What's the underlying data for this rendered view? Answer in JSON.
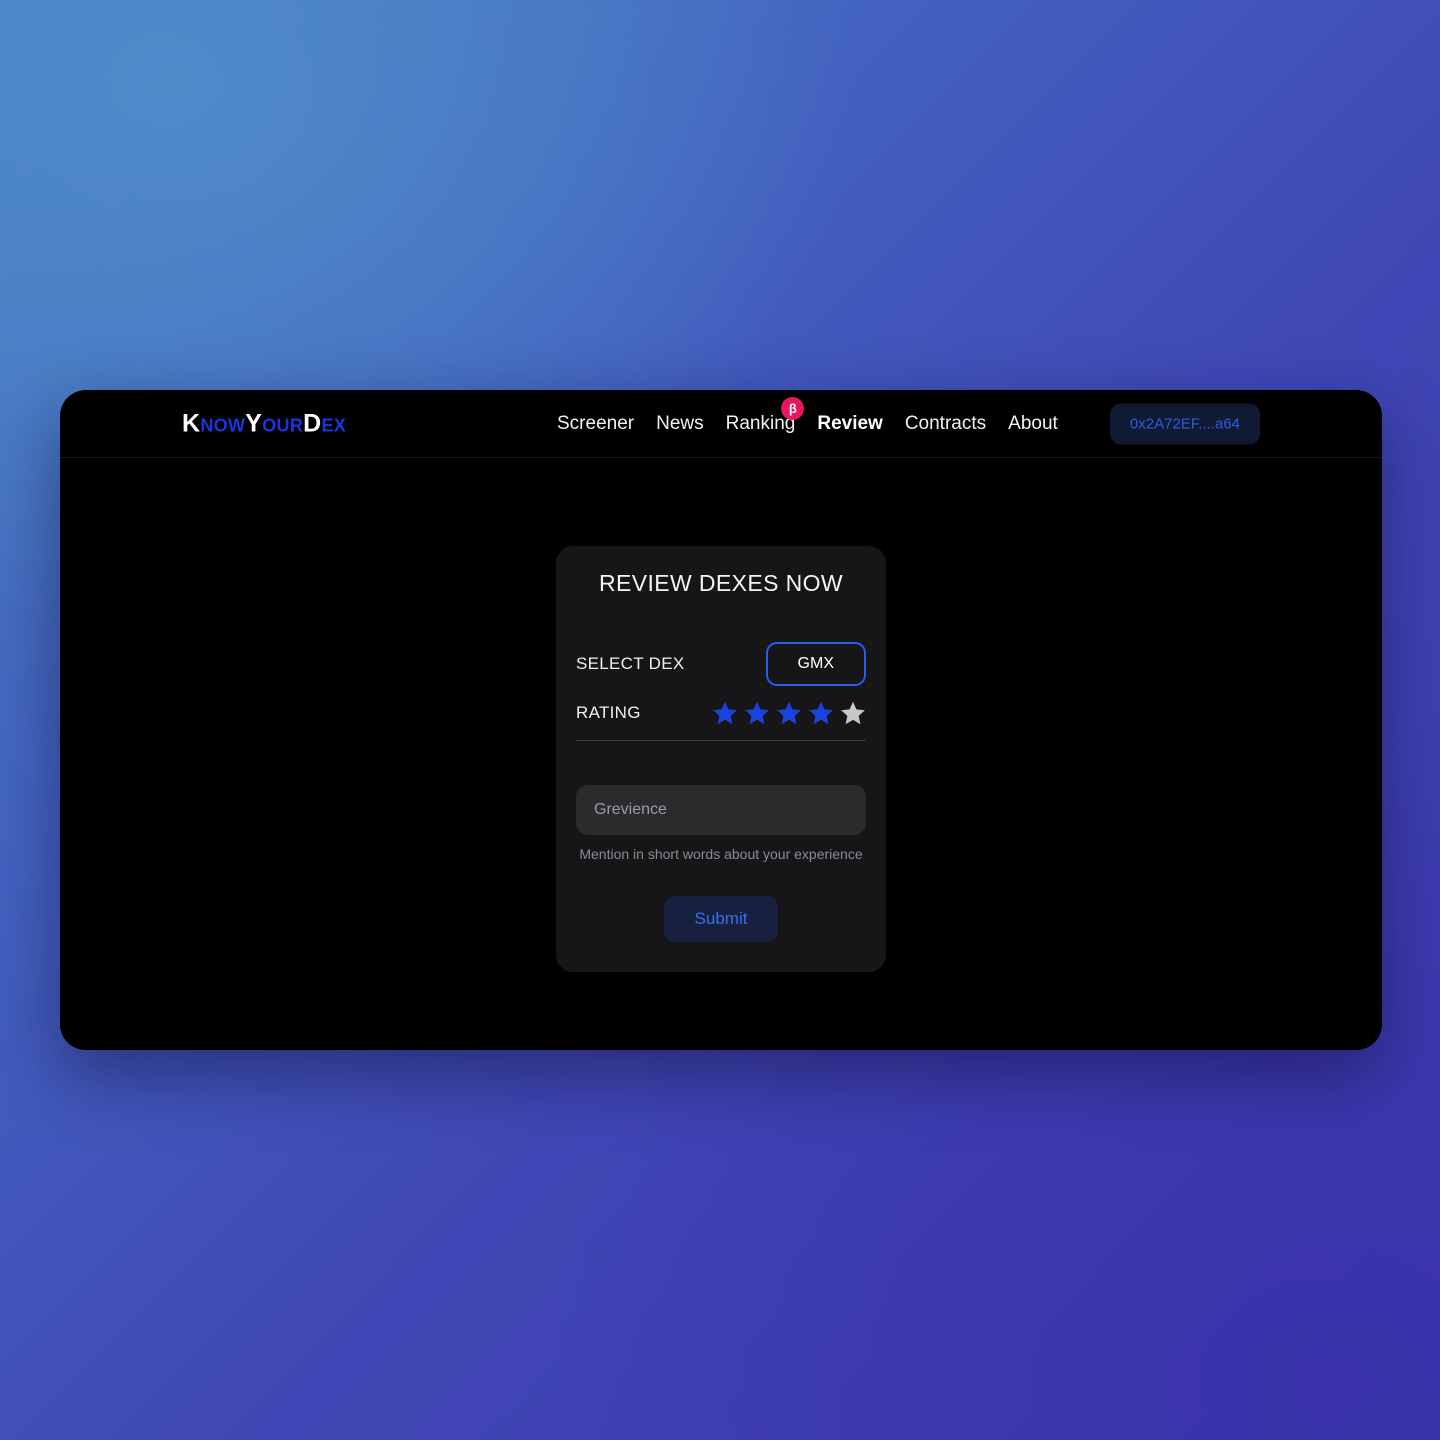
{
  "colors": {
    "accent_blue": "#2b5ce6",
    "star_filled": "#1a44dd",
    "star_empty": "#c8c8c8",
    "beta_badge": "#e8185c",
    "page_bg": "#000000",
    "card_bg": "#161618"
  },
  "header": {
    "logo": {
      "parts": [
        {
          "cap": "K",
          "rest": "NOW"
        },
        {
          "cap": "Y",
          "rest": "OUR"
        },
        {
          "cap": "D",
          "rest": "EX"
        }
      ],
      "full_text": "KnowYourDex"
    },
    "nav": [
      {
        "label": "Screener",
        "active": false,
        "badge": null
      },
      {
        "label": "News",
        "active": false,
        "badge": null
      },
      {
        "label": "Ranking",
        "active": false,
        "badge": "β"
      },
      {
        "label": "Review",
        "active": true,
        "badge": null
      },
      {
        "label": "Contracts",
        "active": false,
        "badge": null
      },
      {
        "label": "About",
        "active": false,
        "badge": null
      }
    ],
    "wallet_label": "0x2A72EF....a64"
  },
  "card": {
    "title": "REVIEW DEXES NOW",
    "select_dex": {
      "label": "SELECT DEX",
      "selected": "GMX"
    },
    "rating": {
      "label": "RATING",
      "value": 4,
      "max": 5
    },
    "grievance": {
      "value": "",
      "placeholder": "Grevience",
      "helper": "Mention in short words about your experience"
    },
    "submit_label": "Submit"
  }
}
